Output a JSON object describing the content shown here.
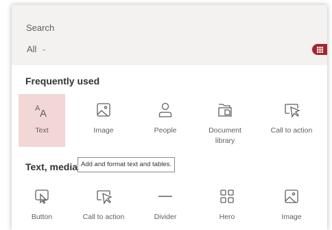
{
  "search": {
    "placeholder": "Search"
  },
  "filter": {
    "label": "All"
  },
  "colors": {
    "accent": "#a4262c",
    "selected_tile": "#f2d7d7",
    "search_bg": "#f3f2f1"
  },
  "sections": [
    {
      "title": "Frequently used",
      "items": [
        {
          "label": "Text",
          "icon": "text-icon",
          "selected": true
        },
        {
          "label": "Image",
          "icon": "image-icon"
        },
        {
          "label": "People",
          "icon": "people-icon"
        },
        {
          "label": "Document library",
          "icon": "document-library-icon"
        },
        {
          "label": "Call to action",
          "icon": "call-to-action-icon"
        }
      ]
    },
    {
      "title": "Text, media",
      "items": [
        {
          "label": "Button",
          "icon": "button-icon"
        },
        {
          "label": "Call to action",
          "icon": "call-to-action-icon"
        },
        {
          "label": "Divider",
          "icon": "divider-icon"
        },
        {
          "label": "Hero",
          "icon": "hero-icon"
        },
        {
          "label": "Image",
          "icon": "image-icon"
        }
      ]
    }
  ],
  "tooltip": {
    "text": "Add and format text and tables."
  }
}
